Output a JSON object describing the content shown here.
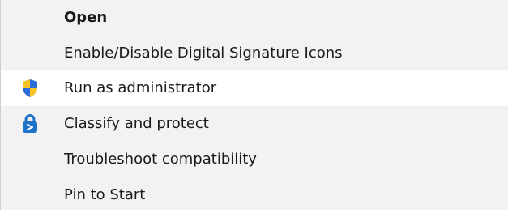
{
  "menu": {
    "items": [
      {
        "label": "Open",
        "bold": true,
        "icon": null
      },
      {
        "label": "Enable/Disable Digital Signature Icons",
        "bold": false,
        "icon": null
      },
      {
        "label": "Run as administrator",
        "bold": false,
        "icon": "uac-shield-icon",
        "highlighted": true
      },
      {
        "label": "Classify and protect",
        "bold": false,
        "icon": "aip-protect-icon"
      },
      {
        "label": "Troubleshoot compatibility",
        "bold": false,
        "icon": null
      },
      {
        "label": "Pin to Start",
        "bold": false,
        "icon": null
      }
    ]
  },
  "colors": {
    "menu_background": "#f2f2f2",
    "highlight": "#ffffff",
    "shield_blue": "#2b6cd8",
    "shield_yellow": "#f7c325",
    "aip_blue": "#1f72c9"
  }
}
